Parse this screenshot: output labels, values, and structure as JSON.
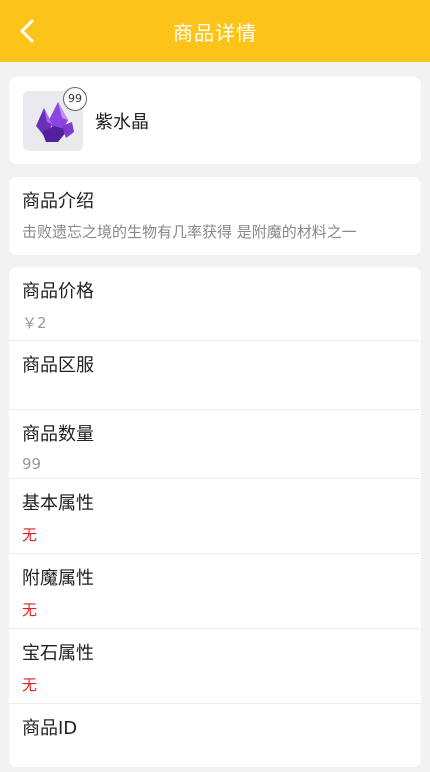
{
  "header": {
    "title": "商品详情"
  },
  "item": {
    "name": "紫水晶",
    "count": "99"
  },
  "intro": {
    "label": "商品介绍",
    "description": "击败遗忘之境的生物有几率获得 是附魔的材料之一"
  },
  "details": [
    {
      "label": "商品价格",
      "value": "￥2"
    },
    {
      "label": "商品区服",
      "value": ""
    },
    {
      "label": "商品数量",
      "value": "99"
    },
    {
      "label": "基本属性",
      "value": "无"
    },
    {
      "label": "附魔属性",
      "value": "无"
    },
    {
      "label": "宝石属性",
      "value": "无"
    },
    {
      "label": "商品ID",
      "value": ""
    }
  ],
  "colors": {
    "header": "#fcc419",
    "empty_attr": "#e02020"
  },
  "icons": {
    "back": "chevron-left-icon",
    "item": "amethyst-crystal-icon"
  }
}
